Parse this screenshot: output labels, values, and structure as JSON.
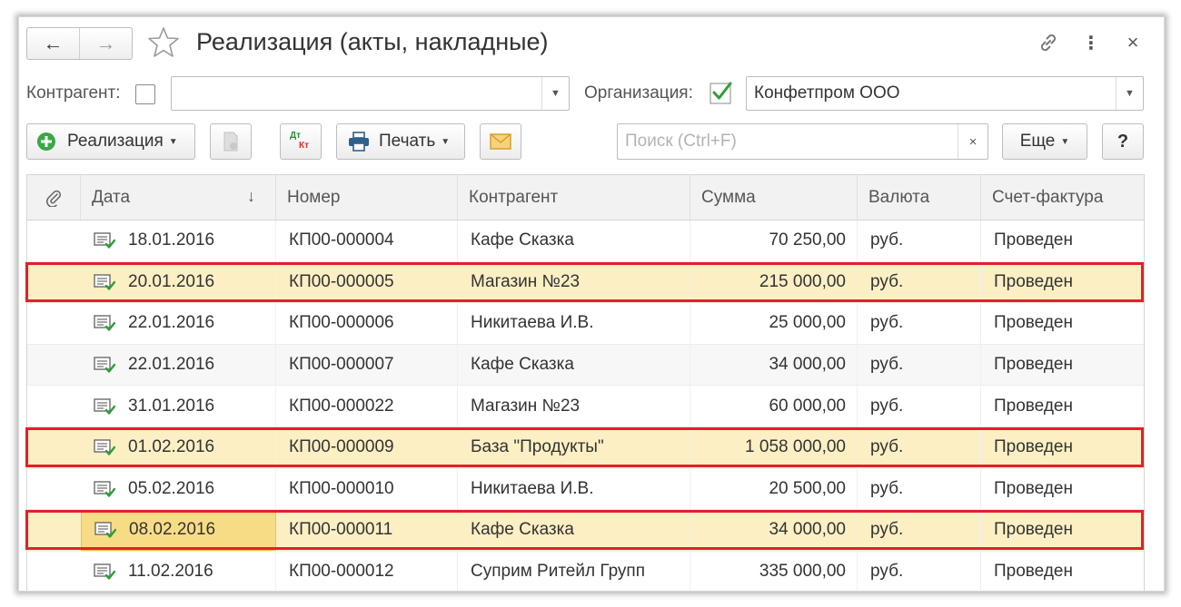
{
  "window": {
    "title": "Реализация (акты, накладные)",
    "back_label": "←",
    "forward_label": "→",
    "more_label": "⋮",
    "close_label": "×"
  },
  "filters": {
    "counterparty_label": "Контрагент:",
    "counterparty_checked": false,
    "counterparty_value": "",
    "organization_label": "Организация:",
    "organization_checked": true,
    "organization_value": "Конфетпром ООО"
  },
  "toolbar": {
    "create_label": "Реализация",
    "print_label": "Печать",
    "dtkt_top": "Дт",
    "dtkt_bottom": "Кт",
    "search_placeholder": "Поиск (Ctrl+F)",
    "search_clear": "×",
    "more_label": "Еще",
    "help_label": "?"
  },
  "table": {
    "columns": [
      "Дата",
      "Номер",
      "Контрагент",
      "Сумма",
      "Валюта",
      "Счет-фактура"
    ],
    "sort_indicator": "↓",
    "rows": [
      {
        "date": "18.01.2016",
        "number": "КП00-000004",
        "counterparty": "Кафе Сказка",
        "sum": "70 250,00",
        "currency": "руб.",
        "invoice": "Проведен",
        "highlighted": false
      },
      {
        "date": "20.01.2016",
        "number": "КП00-000005",
        "counterparty": "Магазин №23",
        "sum": "215 000,00",
        "currency": "руб.",
        "invoice": "Проведен",
        "highlighted": true
      },
      {
        "date": "22.01.2016",
        "number": "КП00-000006",
        "counterparty": "Никитаева И.В.",
        "sum": "25 000,00",
        "currency": "руб.",
        "invoice": "Проведен",
        "highlighted": false
      },
      {
        "date": "22.01.2016",
        "number": "КП00-000007",
        "counterparty": "Кафе Сказка",
        "sum": "34 000,00",
        "currency": "руб.",
        "invoice": "Проведен",
        "highlighted": false
      },
      {
        "date": "31.01.2016",
        "number": "КП00-000022",
        "counterparty": "Магазин №23",
        "sum": "60 000,00",
        "currency": "руб.",
        "invoice": "Проведен",
        "highlighted": false
      },
      {
        "date": "01.02.2016",
        "number": "КП00-000009",
        "counterparty": "База \"Продукты\"",
        "sum": "1 058 000,00",
        "currency": "руб.",
        "invoice": "Проведен",
        "highlighted": true
      },
      {
        "date": "05.02.2016",
        "number": "КП00-000010",
        "counterparty": "Никитаева И.В.",
        "sum": "20 500,00",
        "currency": "руб.",
        "invoice": "Проведен",
        "highlighted": false
      },
      {
        "date": "08.02.2016",
        "number": "КП00-000011",
        "counterparty": "Кафе Сказка",
        "sum": "34 000,00",
        "currency": "руб.",
        "invoice": "Проведен",
        "highlighted": true,
        "current": true
      },
      {
        "date": "11.02.2016",
        "number": "КП00-000012",
        "counterparty": "Суприм Ритейл Групп",
        "sum": "335 000,00",
        "currency": "руб.",
        "invoice": "Проведен",
        "highlighted": false
      }
    ]
  },
  "colors": {
    "highlight_border": "#e3202a",
    "selected_row": "#fcefc3",
    "current_cell": "#f8dc85",
    "check_green": "#2e9e3a",
    "add_green": "#3aa845"
  },
  "icons": [
    "back-arrow-icon",
    "forward-arrow-icon",
    "favorite-star-icon",
    "link-icon",
    "more-vertical-icon",
    "close-icon",
    "add-circle-icon",
    "dropdown-arrow-icon",
    "copy-document-icon",
    "dt-kt-icon",
    "printer-icon",
    "envelope-icon",
    "clear-icon",
    "attachment-icon",
    "sort-arrow-icon",
    "document-posted-icon"
  ]
}
